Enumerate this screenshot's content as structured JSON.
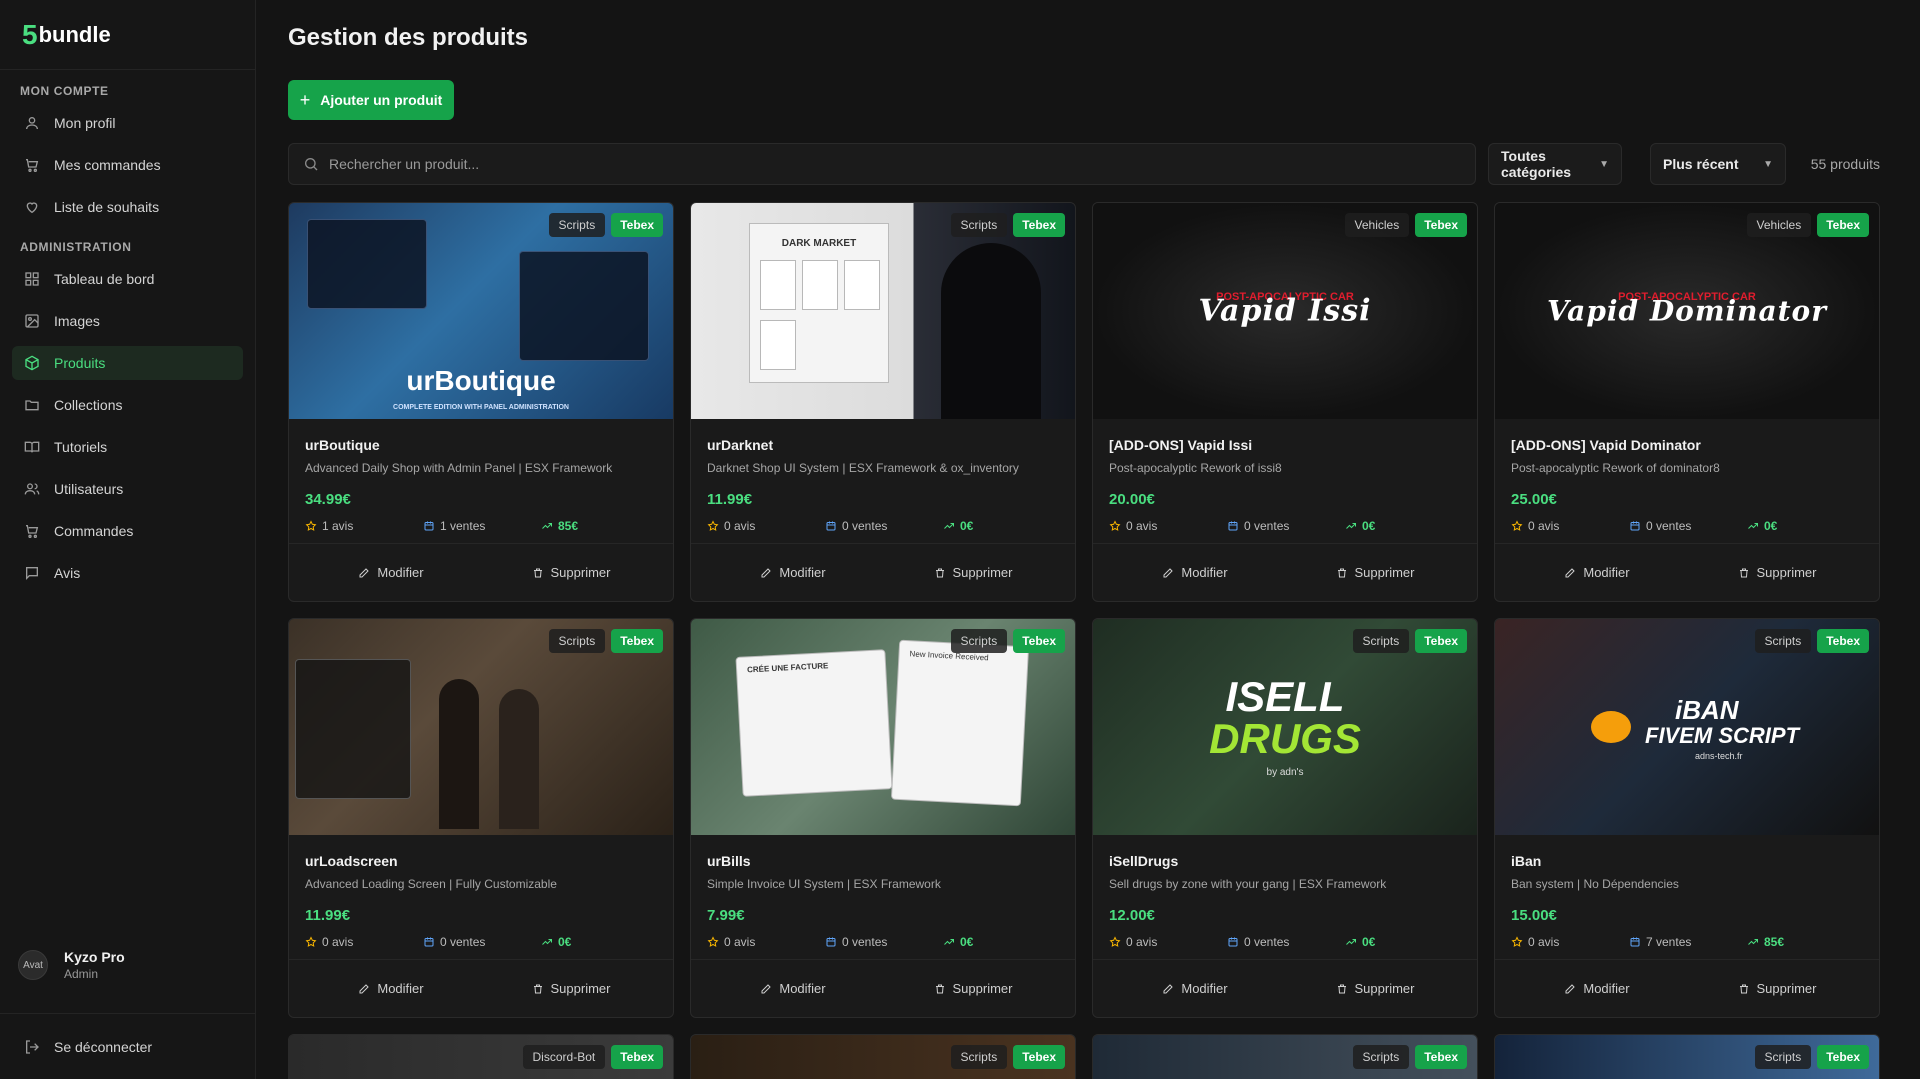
{
  "brand": {
    "num": "5",
    "name": "bundle",
    "accent": "#4ade80"
  },
  "sidebar": {
    "account_title": "MON COMPTE",
    "account_items": [
      {
        "label": "Mon profil",
        "icon": "user-icon"
      },
      {
        "label": "Mes commandes",
        "icon": "cart-icon"
      },
      {
        "label": "Liste de souhaits",
        "icon": "heart-icon"
      }
    ],
    "admin_title": "ADMINISTRATION",
    "admin_items": [
      {
        "label": "Tableau de bord",
        "icon": "dashboard-icon"
      },
      {
        "label": "Images",
        "icon": "image-icon"
      },
      {
        "label": "Produits",
        "icon": "box-icon",
        "active": true
      },
      {
        "label": "Collections",
        "icon": "folder-icon"
      },
      {
        "label": "Tutoriels",
        "icon": "book-icon"
      },
      {
        "label": "Utilisateurs",
        "icon": "users-icon"
      },
      {
        "label": "Commandes",
        "icon": "cart-icon"
      },
      {
        "label": "Avis",
        "icon": "message-icon"
      }
    ],
    "user": {
      "name": "Kyzo Pro",
      "role": "Admin",
      "avatar_alt": "Avat"
    },
    "logout": "Se déconnecter"
  },
  "main": {
    "title": "Gestion des produits",
    "add_button": "Ajouter un produit",
    "search_placeholder": "Rechercher un produit...",
    "category_select": "Toutes catégories",
    "sort_select": "Plus récent",
    "count": "55 produits",
    "edit_label": "Modifier",
    "delete_label": "Supprimer"
  },
  "products": [
    {
      "name": "urBoutique",
      "desc": "Advanced Daily Shop with Admin Panel | ESX Framework",
      "price": "34.99€",
      "reviews": "1 avis",
      "sales": "1 ventes",
      "revenue": "85€",
      "category": "Scripts",
      "platform": "Tebex",
      "thumb_text": "urBoutique",
      "thumb_sub": "COMPLETE EDITION WITH PANEL ADMINISTRATION"
    },
    {
      "name": "urDarknet",
      "desc": "Darknet Shop UI System | ESX Framework & ox_inventory",
      "price": "11.99€",
      "reviews": "0 avis",
      "sales": "0 ventes",
      "revenue": "0€",
      "category": "Scripts",
      "platform": "Tebex",
      "thumb_text": "DARK MARKET"
    },
    {
      "name": "[ADD-ONS] Vapid Issi",
      "desc": "Post-apocalyptic Rework of issi8",
      "price": "20.00€",
      "reviews": "0 avis",
      "sales": "0 ventes",
      "revenue": "0€",
      "category": "Vehicles",
      "platform": "Tebex",
      "thumb_text": "Vapid Issi",
      "thumb_sub": "POST-APOCALYPTIC CAR"
    },
    {
      "name": "[ADD-ONS] Vapid Dominator",
      "desc": "Post-apocalyptic Rework of dominator8",
      "price": "25.00€",
      "reviews": "0 avis",
      "sales": "0 ventes",
      "revenue": "0€",
      "category": "Vehicles",
      "platform": "Tebex",
      "thumb_text": "Vapid Dominator",
      "thumb_sub": "POST-APOCALYPTIC CAR"
    },
    {
      "name": "urLoadscreen",
      "desc": "Advanced Loading Screen | Fully Customizable",
      "price": "11.99€",
      "reviews": "0 avis",
      "sales": "0 ventes",
      "revenue": "0€",
      "category": "Scripts",
      "platform": "Tebex"
    },
    {
      "name": "urBills",
      "desc": "Simple Invoice UI System | ESX Framework",
      "price": "7.99€",
      "reviews": "0 avis",
      "sales": "0 ventes",
      "revenue": "0€",
      "category": "Scripts",
      "platform": "Tebex",
      "thumb_text": "CRÉE UNE FACTURE",
      "thumb_text2": "New Invoice Received"
    },
    {
      "name": "iSellDrugs",
      "desc": "Sell drugs by zone with your gang | ESX Framework",
      "price": "12.00€",
      "reviews": "0 avis",
      "sales": "0 ventes",
      "revenue": "0€",
      "category": "Scripts",
      "platform": "Tebex",
      "thumb_text": "ISELL",
      "thumb_text2": "DRUGS",
      "thumb_sub": "by adn's"
    },
    {
      "name": "iBan",
      "desc": "Ban system | No Dépendencies",
      "price": "15.00€",
      "reviews": "0 avis",
      "sales": "7 ventes",
      "revenue": "85€",
      "category": "Scripts",
      "platform": "Tebex",
      "thumb_text": "iBAN",
      "thumb_text2": "FIVEM SCRIPT",
      "thumb_sub": "adns-tech.fr"
    }
  ],
  "partial_products": [
    {
      "category": "Discord-Bot",
      "platform": "Tebex"
    },
    {
      "category": "Scripts",
      "platform": "Tebex"
    },
    {
      "category": "Scripts",
      "platform": "Tebex"
    },
    {
      "category": "Scripts",
      "platform": "Tebex"
    }
  ]
}
